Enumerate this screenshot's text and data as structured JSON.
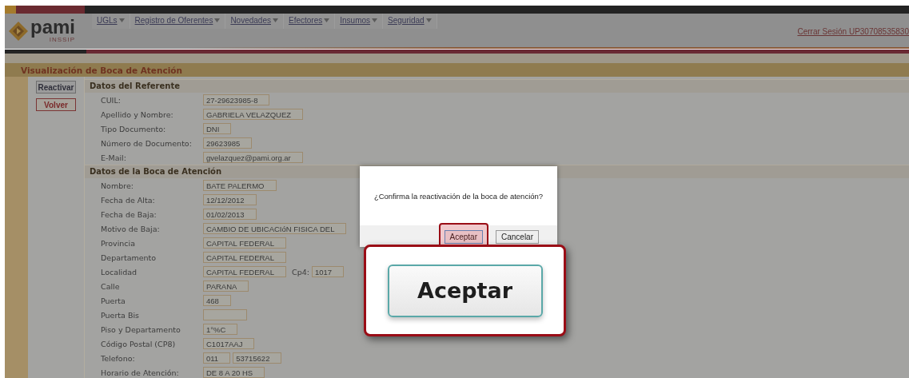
{
  "logo": {
    "name": "pami",
    "subtitle": "INSSIP"
  },
  "menu": [
    {
      "label": "UGLs"
    },
    {
      "label": "Registro de Oferentes"
    },
    {
      "label": "Novedades"
    },
    {
      "label": "Efectores"
    },
    {
      "label": "Insumos"
    },
    {
      "label": "Seguridad"
    }
  ],
  "logout": "Cerrar Sesión UP30708535830",
  "page_title": "Visualización de Boca de Atención",
  "actions": [
    {
      "label": "Reactivar",
      "kind": "primary"
    },
    {
      "label": "Volver",
      "kind": "back"
    }
  ],
  "sections": [
    {
      "title": "Datos del Referente",
      "fields": [
        {
          "label": "CUIL:",
          "values": [
            "27-29623985-8"
          ]
        },
        {
          "label": "Apellido y Nombre:",
          "values": [
            "GABRIELA VELAZQUEZ"
          ]
        },
        {
          "label": "Tipo Documento:",
          "values": [
            "DNI"
          ]
        },
        {
          "label": "Número de Documento:",
          "values": [
            "29623985"
          ]
        },
        {
          "label": "E-Mail:",
          "values": [
            "gvelazquez@pami.org.ar"
          ]
        }
      ]
    },
    {
      "title": "Datos de la Boca de Atención",
      "fields": [
        {
          "label": "Nombre:",
          "values": [
            "BATE PALERMO"
          ]
        },
        {
          "label": "Fecha de Alta:",
          "values": [
            "12/12/2012"
          ]
        },
        {
          "label": "Fecha de Baja:",
          "values": [
            "01/02/2013"
          ]
        },
        {
          "label": "Motivo de Baja:",
          "values": [
            "CAMBIO DE UBICACIóN FISICA DEL"
          ]
        },
        {
          "label": "Provincia",
          "values": [
            "CAPITAL FEDERAL"
          ]
        },
        {
          "label": "Departamento",
          "values": [
            "CAPITAL FEDERAL"
          ]
        },
        {
          "label": "Localidad",
          "values": [
            "CAPITAL FEDERAL"
          ],
          "extra": {
            "label": "Cp4:",
            "value": "1017"
          }
        },
        {
          "label": "Calle",
          "values": [
            "PARANA"
          ]
        },
        {
          "label": "Puerta",
          "values": [
            "468"
          ]
        },
        {
          "label": "Puerta Bis"
        },
        {
          "label": "Piso y Departamento",
          "values": [
            "1°%C"
          ]
        },
        {
          "label": "Código Postal (CP8)",
          "values": [
            "C1017AAJ"
          ]
        },
        {
          "label": "Telefono:",
          "values": [
            "011",
            "53715622"
          ]
        },
        {
          "label": "Horario de Atención:",
          "values": [
            "DE 8 A 20 HS"
          ]
        }
      ]
    }
  ],
  "dialog": {
    "message": "¿Confirma la reactivación de la boca de atención?",
    "buttons": [
      {
        "label": "Aceptar",
        "highlighted": true
      },
      {
        "label": "Cancelar",
        "highlighted": false
      }
    ]
  },
  "callout": {
    "label": "Aceptar"
  }
}
